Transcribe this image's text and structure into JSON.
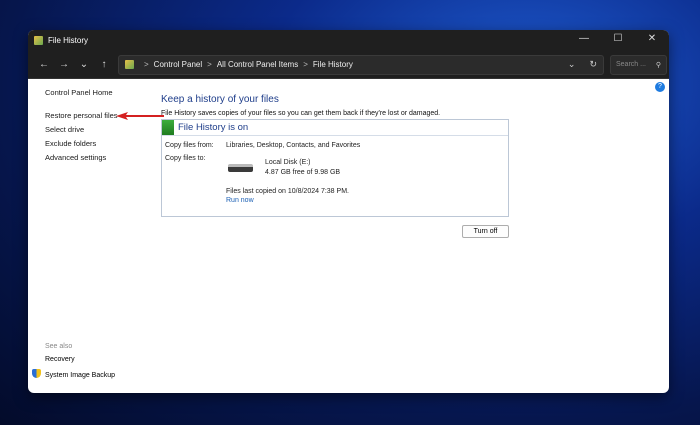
{
  "window": {
    "title": "File History",
    "minimize": "—",
    "maximize": "☐",
    "close": "✕"
  },
  "nav": {
    "back": "←",
    "forward": "→",
    "recent": "⌄",
    "up": "↑"
  },
  "address": {
    "crumbs": [
      "Control Panel",
      "All Control Panel Items",
      "File History"
    ],
    "separator": ">",
    "dropdown": "⌄",
    "refresh": "↻"
  },
  "search": {
    "placeholder": "Search ...",
    "icon": "⚲"
  },
  "sidebar": {
    "home": "Control Panel Home",
    "items": [
      "Restore personal files",
      "Select drive",
      "Exclude folders",
      "Advanced settings"
    ]
  },
  "see_also": {
    "label": "See also",
    "items": [
      "Recovery",
      "System Image Backup"
    ]
  },
  "help": "?",
  "main": {
    "title": "Keep a history of your files",
    "description": "File History saves copies of your files so you can get them back if they're lost or damaged.",
    "status": "File History is on",
    "from_label": "Copy files from:",
    "from_value": "Libraries, Desktop, Contacts, and Favorites",
    "to_label": "Copy files to:",
    "drive_name": "Local Disk (E:)",
    "drive_space": "4.87 GB free of 9.98 GB",
    "last_copied": "Files last copied on 10/8/2024 7:38 PM.",
    "run_now": "Run now",
    "turn_off": "Turn off"
  },
  "colors": {
    "accent": "#1e3d8a",
    "status_green": "#2a9a2a",
    "annotation_arrow": "#d42020"
  }
}
